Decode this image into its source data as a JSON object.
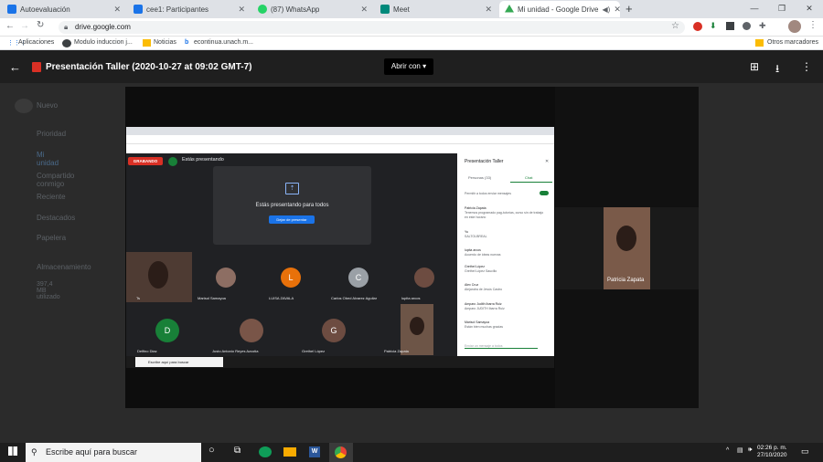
{
  "browser": {
    "tabs": [
      {
        "label": "Autoevaluación",
        "color": "#1a73e8"
      },
      {
        "label": "cee1: Participantes",
        "color": "#1a73e8"
      },
      {
        "label": "(87) WhatsApp",
        "color": "#25d366"
      },
      {
        "label": "Meet",
        "color": "#00897b"
      },
      {
        "label": "Mi unidad - Google Drive",
        "color": "#34a853"
      }
    ],
    "url": "drive.google.com",
    "bookmarks": [
      "Aplicaciones",
      "Modulo induccion j...",
      "Noticias",
      "econtinua.unach.m...",
      "Otros marcadores"
    ]
  },
  "viewer": {
    "title": "Presentación Taller (2020-10-27 at 09:02 GMT-7)",
    "open_with": "Abrir con"
  },
  "drive_bg": {
    "new": "Nuevo",
    "nav": [
      "Prioridad",
      "Mi unidad",
      "Compartido conmigo",
      "Reciente",
      "Destacados",
      "Papelera",
      "Almacenamiento"
    ],
    "storage": "397,4 MB utilizado"
  },
  "meet": {
    "recording": "GRABANDO",
    "presenting": "Estás presentando",
    "presenting_all": "Estás presentando para todos",
    "stop_button": "Dejar de presentar",
    "participants": [
      {
        "name": "Ts",
        "initial": "",
        "color": "#5f6368"
      },
      {
        "name": "Marisol Samayoa",
        "initial": "",
        "color": "#8d6e63"
      },
      {
        "name": "LUISA ZAVALA",
        "initial": "L",
        "color": "#e8710a"
      },
      {
        "name": "Carlos Obed Alvarez Aguilar",
        "initial": "C",
        "color": "#9aa0a6"
      },
      {
        "name": "lupita arcos",
        "initial": "",
        "color": "#6d4c41"
      },
      {
        "name": "Delfino Diaz",
        "initial": "D",
        "color": "#188038"
      },
      {
        "name": "Justo Antonio Reyes Azcotia",
        "initial": "",
        "color": "#795548"
      },
      {
        "name": "Grethel López",
        "initial": "G",
        "color": "#6d4c41"
      },
      {
        "name": "Patricia Zapata",
        "initial": "",
        "color": "#8d6e63"
      }
    ],
    "chat_title": "Presentación Taller",
    "chat_tabs": [
      "Personas (33)",
      "Chat"
    ],
    "chat_toggle": "Permitir a todos enviar mensajes",
    "messages": [
      {
        "author": "Patricia Zapata",
        "text": "Tenemos programado pag-tutorías, curso sin de trabajo en este horario"
      },
      {
        "author": "Yu",
        "text": "SALTOLBREAL"
      },
      {
        "author": "lupita arcos",
        "text": "Acuerdo de ideas nuevas"
      },
      {
        "author": "Grethel López",
        "text": "Grethel López Saucillo"
      },
      {
        "author": "Alex Cruz",
        "text": "Alejandra de Jesús Castro"
      },
      {
        "author": "Amparo Judith Ibarra Ruiz",
        "text": "Amparo JUDITH Ibarra Ruiz"
      },
      {
        "author": "Marisol Samayoa",
        "text": "Están bien muchas gracias"
      }
    ],
    "chat_input": "Enviar un mensaje a todos",
    "inner_search": "Escribe aquí para buscar"
  },
  "speaker_tile": "Patricia Zapata",
  "taskbar": {
    "search": "Escribe aquí para buscar",
    "time": "02:26 p. m.",
    "date": "27/10/2020"
  }
}
